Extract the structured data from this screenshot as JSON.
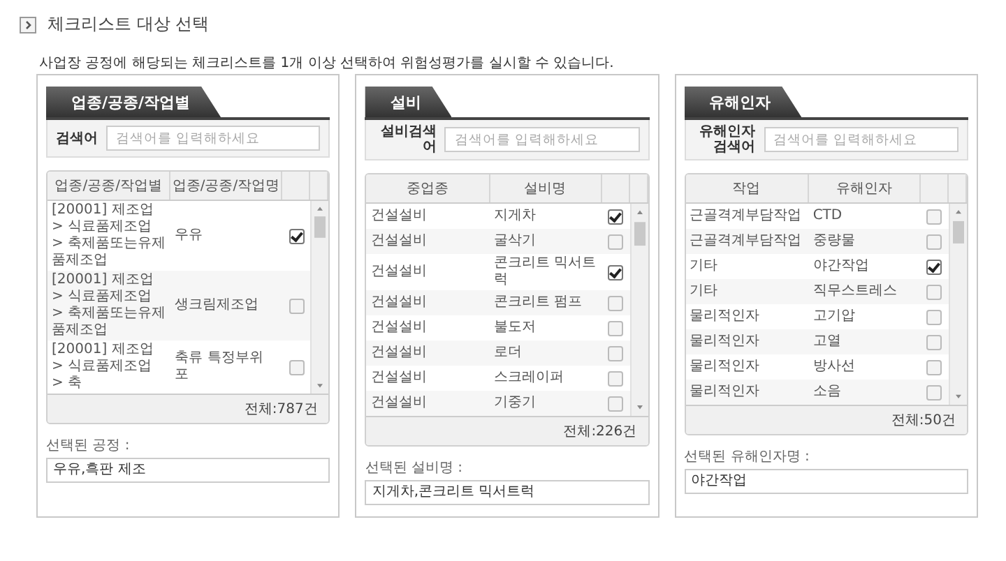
{
  "section_title": "체크리스트 대상 선택",
  "description": "사업장 공정에 해당되는 체크리스트를 1개 이상 선택하여 위험성평가를 실시할 수 있습니다.",
  "panels": [
    {
      "tab": "업종/공종/작업별",
      "search_label": "검색어",
      "search": {
        "placeholder": "검색어를 입력해하세요"
      },
      "columns": [
        "업종/공종/작업별",
        "업종/공종/작업명"
      ],
      "rows": [
        {
          "cells": [
            "[20001] 제조업 > 식료품제조업 > 축제품또는유제품제조업",
            "우유"
          ],
          "checked": true
        },
        {
          "cells": [
            "[20001] 제조업 > 식료품제조업 > 축제품또는유제품제조업",
            "생크림제조업"
          ],
          "checked": false
        },
        {
          "cells": [
            "[20001] 제조업 > 식료품제조업 > 축",
            "축류 특정부위 포"
          ],
          "checked": false
        }
      ],
      "total": "전체:787건",
      "selected_label": "선택된 공정 :",
      "selected_value": "우유,흑판 제조"
    },
    {
      "tab": "설비",
      "search_label": "설비검색어",
      "search": {
        "placeholder": "검색어를 입력해하세요"
      },
      "columns": [
        "중업종",
        "설비명"
      ],
      "rows": [
        {
          "cells": [
            "건설설비",
            "지게차"
          ],
          "checked": true
        },
        {
          "cells": [
            "건설설비",
            "굴삭기"
          ],
          "checked": false
        },
        {
          "cells": [
            "건설설비",
            "콘크리트 믹서트럭"
          ],
          "checked": true
        },
        {
          "cells": [
            "건설설비",
            "콘크리트 펌프"
          ],
          "checked": false
        },
        {
          "cells": [
            "건설설비",
            "불도저"
          ],
          "checked": false
        },
        {
          "cells": [
            "건설설비",
            "로더"
          ],
          "checked": false
        },
        {
          "cells": [
            "건설설비",
            "스크레이퍼"
          ],
          "checked": false
        },
        {
          "cells": [
            "건설설비",
            "기중기"
          ],
          "checked": false
        }
      ],
      "total": "전체:226건",
      "selected_label": "선택된 설비명 :",
      "selected_value": "지게차,콘크리트 믹서트럭"
    },
    {
      "tab": "유해인자",
      "search_label": "유해인자검색어",
      "search": {
        "placeholder": "검색어를 입력해하세요"
      },
      "columns": [
        "작업",
        "유해인자"
      ],
      "rows": [
        {
          "cells": [
            "근골격계부담작업",
            "CTD"
          ],
          "checked": false
        },
        {
          "cells": [
            "근골격계부담작업",
            "중량물"
          ],
          "checked": false
        },
        {
          "cells": [
            "기타",
            "야간작업"
          ],
          "checked": true
        },
        {
          "cells": [
            "기타",
            "직무스트레스"
          ],
          "checked": false
        },
        {
          "cells": [
            "물리적인자",
            "고기압"
          ],
          "checked": false
        },
        {
          "cells": [
            "물리적인자",
            "고열"
          ],
          "checked": false
        },
        {
          "cells": [
            "물리적인자",
            "방사선"
          ],
          "checked": false
        },
        {
          "cells": [
            "물리적인자",
            "소음"
          ],
          "checked": false
        }
      ],
      "total": "전체:50건",
      "selected_label": "선택된 유해인자명 :",
      "selected_value": "야간작업"
    }
  ]
}
